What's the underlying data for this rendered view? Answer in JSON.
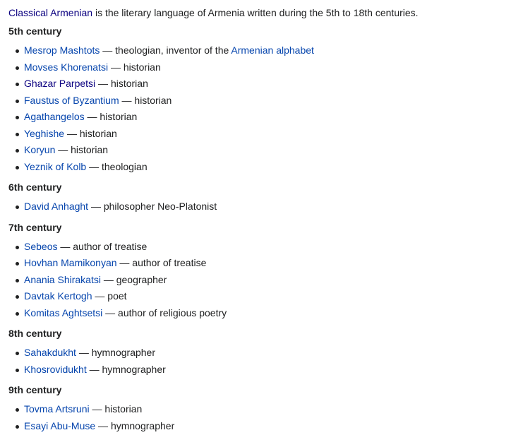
{
  "intro": {
    "link": "Classical Armenian",
    "text": " is the literary language of Armenia written during the 5th to 18th centuries."
  },
  "sections": [
    {
      "heading": "5th century",
      "items": [
        {
          "link": "Mesrop Mashtots",
          "desc": " — theologian, inventor of the ",
          "desc_link": "Armenian alphabet"
        },
        {
          "link": "Movses Khorenatsi",
          "desc": " — historian"
        },
        {
          "link": "Ghazar Parpetsi",
          "desc": " — historian",
          "visited": true
        },
        {
          "link": "Faustus of Byzantium",
          "desc": " — historian"
        },
        {
          "link": "Agathangelos",
          "desc": " — historian"
        },
        {
          "link": "Yeghishe",
          "desc": " — historian"
        },
        {
          "link": "Koryun",
          "desc": " — historian"
        },
        {
          "link": "Yeznik of Kolb",
          "desc": " — theologian"
        }
      ]
    },
    {
      "heading": "6th century",
      "items": [
        {
          "link": "David Anhaght",
          "desc": " — philosopher Neo-Platonist"
        }
      ]
    },
    {
      "heading": "7th century",
      "items": [
        {
          "link": "Sebeos",
          "desc": " — author of treatise"
        },
        {
          "link": "Hovhan Mamikonyan",
          "desc": " — author of treatise"
        },
        {
          "link": "Anania Shirakatsi",
          "desc": " — geographer"
        },
        {
          "link": "Davtak Kertogh",
          "desc": " — poet"
        },
        {
          "link": "Komitas Aghtsetsi",
          "desc": " — author of religious poetry"
        }
      ]
    },
    {
      "heading": "8th century",
      "items": [
        {
          "link": "Sahakdukht",
          "desc": " — hymnographer"
        },
        {
          "link": "Khosrovidukht",
          "desc": " — hymnographer"
        }
      ]
    },
    {
      "heading": "9th century",
      "items": [
        {
          "link": "Tovma Artsruni",
          "desc": " — historian"
        },
        {
          "link": "Esayi Abu-Muse",
          "desc": " — hymnographer"
        }
      ]
    }
  ]
}
